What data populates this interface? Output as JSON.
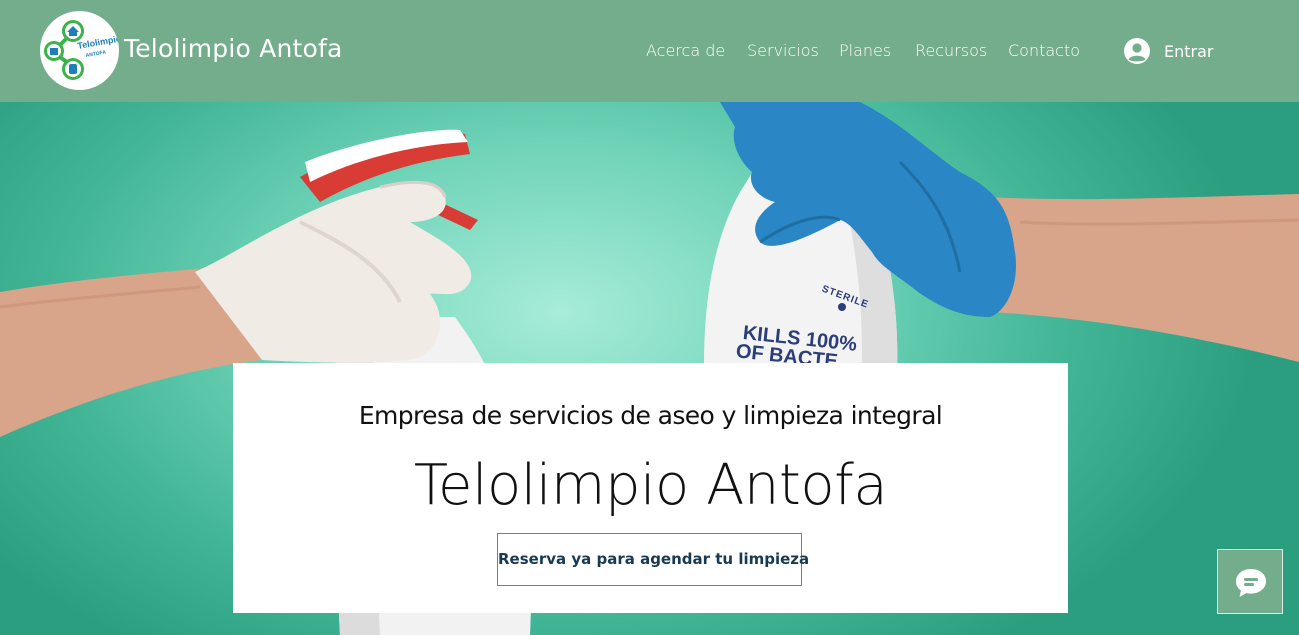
{
  "header": {
    "site_title": "Telolimpio Antofa",
    "logo": {
      "text_line1": "Telolimpio",
      "text_line2": "ANTOFA"
    },
    "nav": [
      {
        "label": "Acerca de"
      },
      {
        "label": "Servicios"
      },
      {
        "label": "Planes"
      },
      {
        "label": "Recursos"
      },
      {
        "label": "Contacto"
      }
    ],
    "login": {
      "label": "Entrar",
      "icon": "user-avatar-icon"
    }
  },
  "hero": {
    "bottle_label_top": "STERILE",
    "bottle_label_main": "KILLS 100%",
    "bottle_label_sub": "OF BACTE"
  },
  "card": {
    "subtitle": "Empresa de servicios de aseo y limpieza integral",
    "title": "Telolimpio Antofa",
    "button_label": "Reserva ya para agendar tu limpieza"
  },
  "chat": {
    "icon": "chat-bubble-icon"
  },
  "colors": {
    "header_bg": "#74ad8c",
    "hero_bg": "#4fb9a0",
    "button_text": "#173a52",
    "glove_blue": "#2a86c4"
  }
}
